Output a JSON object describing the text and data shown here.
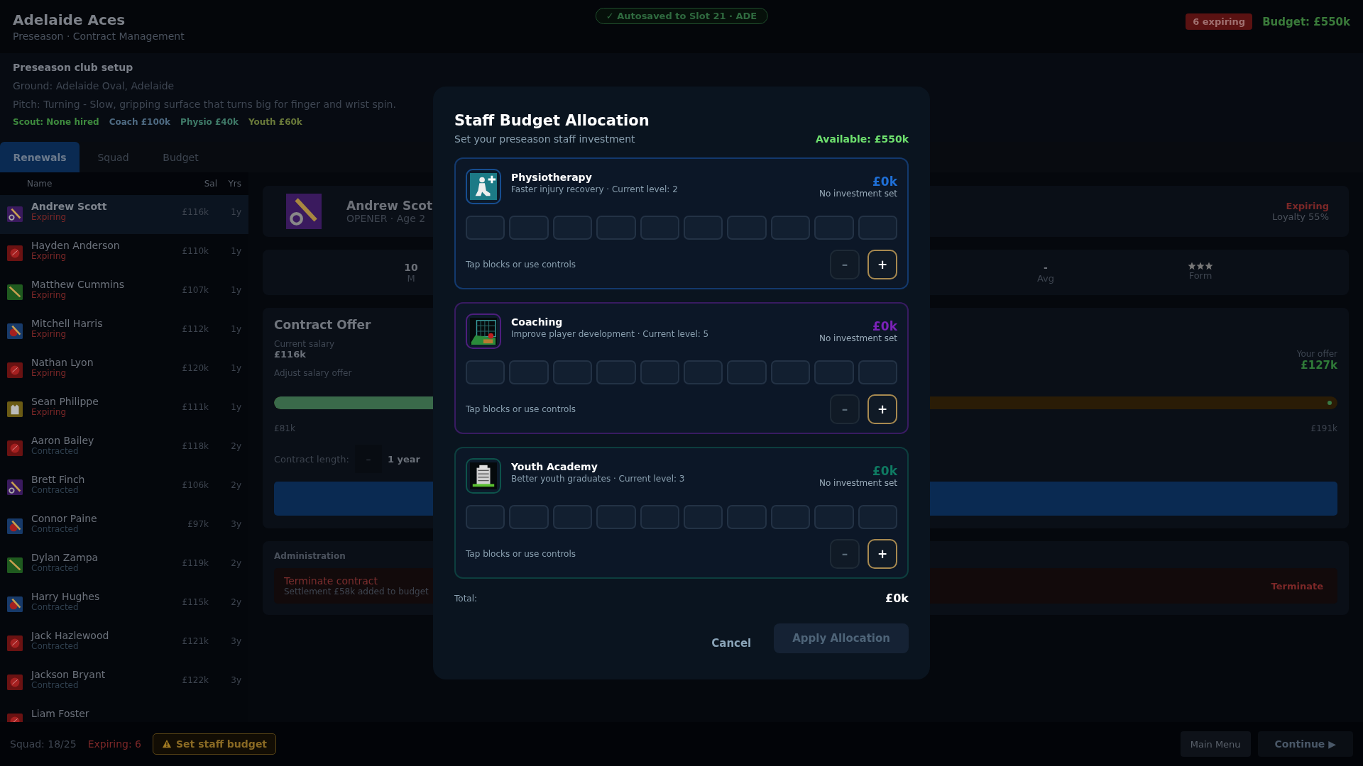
{
  "header": {
    "title": "Adelaide Aces",
    "subtitle": "Preseason · Contract Management",
    "autosave": "✓ Autosaved to Slot 21 · ADE",
    "expiring_badge": "6 expiring",
    "budget": "Budget: £550k"
  },
  "setup": {
    "title": "Preseason club setup",
    "ground": "Ground: Adelaide Oval, Adelaide",
    "pitch": "Pitch: Turning - Slow, gripping surface that turns big for finger and wrist spin.",
    "staff": [
      {
        "text": "Scout: None hired",
        "color": "#3e8a3e"
      },
      {
        "text": "Coach £100k",
        "color": "#4e6a82"
      },
      {
        "text": "Physio £40k",
        "color": "#3f7a68"
      },
      {
        "text": "Youth £60k",
        "color": "#6a7a3a"
      }
    ]
  },
  "tabs": [
    {
      "label": "Renewals",
      "selected": true
    },
    {
      "label": "Squad",
      "selected": false
    },
    {
      "label": "Budget",
      "selected": false
    }
  ],
  "roster": {
    "columns": [
      "Name",
      "Sal",
      "Yrs"
    ],
    "rows": [
      {
        "name": "Andrew Scott",
        "status": "Expiring",
        "expiring": true,
        "salary": "£116k",
        "years": "1y",
        "kind": "opener",
        "selected": true
      },
      {
        "name": "Hayden Anderson",
        "status": "Expiring",
        "expiring": true,
        "salary": "£110k",
        "years": "1y",
        "kind": "bowler",
        "selected": false
      },
      {
        "name": "Matthew Cummins",
        "status": "Expiring",
        "expiring": true,
        "salary": "£107k",
        "years": "1y",
        "kind": "batter",
        "selected": false
      },
      {
        "name": "Mitchell Harris",
        "status": "Expiring",
        "expiring": true,
        "salary": "£112k",
        "years": "1y",
        "kind": "allrounder",
        "selected": false
      },
      {
        "name": "Nathan Lyon",
        "status": "Expiring",
        "expiring": true,
        "salary": "£120k",
        "years": "1y",
        "kind": "bowler",
        "selected": false
      },
      {
        "name": "Sean Philippe",
        "status": "Expiring",
        "expiring": true,
        "salary": "£111k",
        "years": "1y",
        "kind": "keeper",
        "selected": false
      },
      {
        "name": "Aaron Bailey",
        "status": "Contracted",
        "expiring": false,
        "salary": "£118k",
        "years": "2y",
        "kind": "bowler",
        "selected": false
      },
      {
        "name": "Brett Finch",
        "status": "Contracted",
        "expiring": false,
        "salary": "£106k",
        "years": "2y",
        "kind": "opener",
        "selected": false
      },
      {
        "name": "Connor Paine",
        "status": "Contracted",
        "expiring": false,
        "salary": "£97k",
        "years": "3y",
        "kind": "allrounder",
        "selected": false
      },
      {
        "name": "Dylan Zampa",
        "status": "Contracted",
        "expiring": false,
        "salary": "£119k",
        "years": "2y",
        "kind": "batter",
        "selected": false
      },
      {
        "name": "Harry Hughes",
        "status": "Contracted",
        "expiring": false,
        "salary": "£115k",
        "years": "2y",
        "kind": "allrounder",
        "selected": false
      },
      {
        "name": "Jack Hazlewood",
        "status": "Contracted",
        "expiring": false,
        "salary": "£121k",
        "years": "3y",
        "kind": "bowler",
        "selected": false
      },
      {
        "name": "Jackson Bryant",
        "status": "Contracted",
        "expiring": false,
        "salary": "£122k",
        "years": "3y",
        "kind": "bowler",
        "selected": false
      },
      {
        "name": "Liam Foster",
        "kind": "bowler",
        "selected": false
      }
    ]
  },
  "player": {
    "name": "Andrew Scot",
    "kind": "opener",
    "meta": "OPENER · Age 2",
    "status": "Expiring",
    "loyalty": "Loyalty 55%"
  },
  "stats_left": [
    {
      "value": "10",
      "label": "M"
    }
  ],
  "stats_right": [
    {
      "value": "-",
      "label": "Avg"
    },
    {
      "stars": 3,
      "label": "Form"
    }
  ],
  "contract": {
    "title": "Contract Offer",
    "current_label": "Current salary",
    "current_value": "£116k",
    "adjust_label": "Adjust salary offer",
    "offer_label": "Your offer",
    "offer_value": "£127k",
    "level": 0.42,
    "min": "£81k",
    "max": "£191k",
    "length_label": "Contract length:",
    "minus": "–",
    "length_value": "1 year"
  },
  "admin": {
    "title": "Administration",
    "action": "Terminate contract",
    "note": "Settlement £58k added to budget",
    "button": "Terminate"
  },
  "footer": {
    "squad": "Squad: 18/25",
    "expiring": "Expiring: 6",
    "staff_button": "Set staff budget",
    "menu_button": "Main Menu",
    "continue_button": "Continue ▶",
    "continue_disabled": true
  },
  "modal": {
    "title": "Staff Budget Allocation",
    "subtitle": "Set your preseason staff investment",
    "available": "Available: £550k",
    "staff": [
      {
        "kind": "physio",
        "name": "Physiotherapy",
        "description": "Faster injury recovery · Current level: 2",
        "amount": "£0k",
        "note": "No investment set",
        "color": "#1f6fd6",
        "blocks": [
          {
            "filled": false
          },
          {
            "filled": false
          },
          {
            "filled": false
          },
          {
            "filled": false
          },
          {
            "filled": false
          },
          {
            "filled": false
          },
          {
            "filled": false
          },
          {
            "filled": false
          },
          {
            "filled": false
          },
          {
            "filled": false
          }
        ],
        "hint": "Tap blocks or use controls",
        "minus": "–",
        "plus": "+",
        "minus_disabled": true
      },
      {
        "kind": "coaching",
        "name": "Coaching",
        "description": "Improve player development · Current level: 5",
        "amount": "£0k",
        "note": "No investment set",
        "color": "#7b22b8",
        "blocks": [
          {
            "filled": false
          },
          {
            "filled": false
          },
          {
            "filled": false
          },
          {
            "filled": false
          },
          {
            "filled": false
          },
          {
            "filled": false
          },
          {
            "filled": false
          },
          {
            "filled": false
          },
          {
            "filled": false
          },
          {
            "filled": false
          }
        ],
        "hint": "Tap blocks or use controls",
        "minus": "–",
        "plus": "+",
        "minus_disabled": true
      },
      {
        "kind": "youth",
        "name": "Youth Academy",
        "description": "Better youth graduates · Current level: 3",
        "amount": "£0k",
        "note": "No investment set",
        "color": "#0f7a62",
        "blocks": [
          {
            "filled": false
          },
          {
            "filled": false
          },
          {
            "filled": false
          },
          {
            "filled": false
          },
          {
            "filled": false
          },
          {
            "filled": false
          },
          {
            "filled": false
          },
          {
            "filled": false
          },
          {
            "filled": false
          },
          {
            "filled": false
          }
        ],
        "hint": "Tap blocks or use controls",
        "minus": "–",
        "plus": "+",
        "minus_disabled": true
      }
    ],
    "total_label": "Total:",
    "total_value": "£0k",
    "cancel": "Cancel",
    "apply": "Apply Allocation",
    "apply_disabled": true
  }
}
